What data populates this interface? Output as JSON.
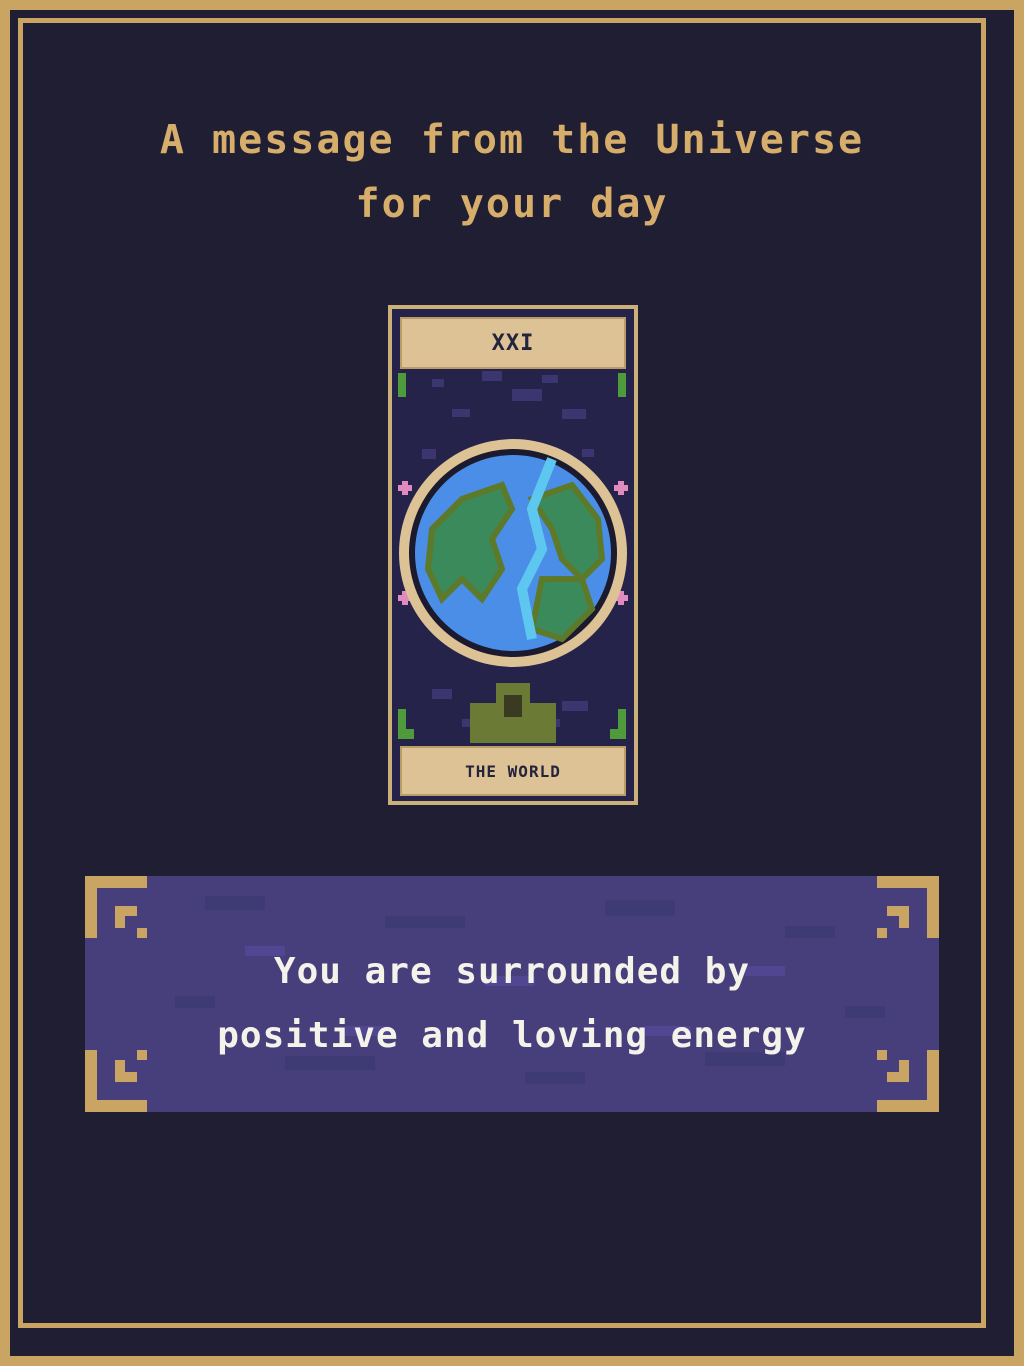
{
  "header": {
    "title_line1": "A message from the Universe",
    "title_line2": "for your day"
  },
  "card": {
    "numeral": "XXI",
    "name": "THE WORLD"
  },
  "message": {
    "line1": "You are surrounded by",
    "line2": "positive and loving energy"
  },
  "colors": {
    "background": "#1f1e33",
    "gold": "#c9a463",
    "title_text": "#d6ad6a",
    "panel": "#463f7c",
    "message_text": "#f5f2ea",
    "card_label": "#dcc295",
    "ocean": "#4a8ee8",
    "land": "#3a8a5c"
  }
}
